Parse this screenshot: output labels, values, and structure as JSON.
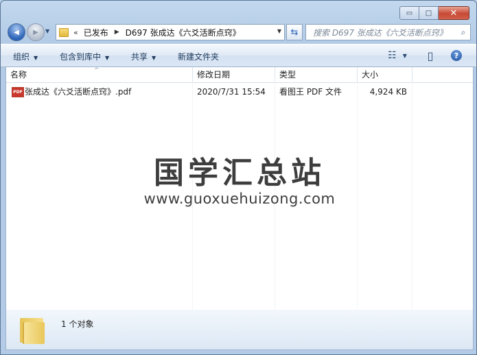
{
  "window": {
    "caption": {
      "minimize": "▭",
      "maximize": "□",
      "close": "✕"
    }
  },
  "nav": {
    "back_glyph": "◀",
    "forward_glyph": "▶",
    "dropdown_glyph": "▼",
    "address": {
      "overflow": "«",
      "segments": [
        "已发布",
        "D697 张成达《六爻活断点窍》"
      ],
      "separator": "▶",
      "dropdown": "▼"
    },
    "refresh_glyph": "⇆",
    "search_placeholder": "搜索 D697 张成达《六爻活断点窍》",
    "search_glyph": "⌕"
  },
  "toolbar": {
    "organize": "组织",
    "include_library": "包含到库中",
    "share": "共享",
    "new_folder": "新建文件夹",
    "arrow": "▼",
    "view_glyph": "☷",
    "preview_glyph": "▯",
    "help": "?"
  },
  "columns": [
    "名称",
    "修改日期",
    "类型",
    "大小"
  ],
  "sort_glyph": "^",
  "files": [
    {
      "icon": "PDF",
      "name": "张成达《六爻活断点窍》.pdf",
      "modified": "2020/7/31 15:54",
      "type": "看图王 PDF 文件",
      "size": "4,924 KB"
    }
  ],
  "watermark": {
    "title": "国学汇总站",
    "url": "www.guoxuehuizong.com"
  },
  "details": {
    "count": "1 个对象"
  },
  "icons": [
    "back-icon",
    "forward-icon",
    "folder-icon",
    "refresh-icon",
    "search-icon",
    "view-icon",
    "preview-pane-icon",
    "help-icon",
    "pdf-icon"
  ]
}
